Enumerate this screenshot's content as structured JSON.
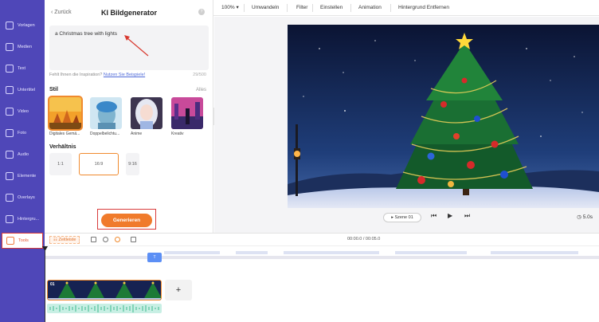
{
  "sidebar": {
    "items": [
      {
        "label": "Vorlagen",
        "icon": "layers-icon",
        "name": "sidebar-item-vorlagen"
      },
      {
        "label": "Medien",
        "icon": "media-icon",
        "name": "sidebar-item-medien"
      },
      {
        "label": "Text",
        "icon": "text-icon",
        "name": "sidebar-item-text"
      },
      {
        "label": "Untertitel",
        "icon": "subtitle-icon",
        "name": "sidebar-item-untertitel"
      },
      {
        "label": "Video",
        "icon": "video-icon",
        "name": "sidebar-item-video"
      },
      {
        "label": "Foto",
        "icon": "photo-icon",
        "name": "sidebar-item-foto"
      },
      {
        "label": "Audio",
        "icon": "music-icon",
        "name": "sidebar-item-audio"
      },
      {
        "label": "Elemente",
        "icon": "shapes-icon",
        "name": "sidebar-item-elemente"
      },
      {
        "label": "Overlays",
        "icon": "overlay-icon",
        "name": "sidebar-item-overlays"
      },
      {
        "label": "Hintergru...",
        "icon": "background-icon",
        "name": "sidebar-item-hintergrund"
      },
      {
        "label": "Tools",
        "icon": "toolbox-icon",
        "name": "sidebar-item-tools",
        "active": true
      }
    ]
  },
  "panel": {
    "back_label": "Zurück",
    "title": "KI Bildgenerator",
    "help_icon": "?",
    "prompt_text": "a Christmas tree with lights",
    "inspiration_text": "Fehlt Ihnen die Inspiration?",
    "inspiration_link": "Nutzen Sie Beispiele!",
    "char_counter": "29/500",
    "style_label": "Stil",
    "all_label": "Alles",
    "styles": [
      {
        "name": "Digitales Gemä...",
        "selected": true
      },
      {
        "name": "Doppelbelichtu..."
      },
      {
        "name": "Anime"
      },
      {
        "name": "Kreativ"
      }
    ],
    "ratio_label": "Verhältnis",
    "ratios": [
      {
        "label": "1:1"
      },
      {
        "label": "16:9",
        "selected": true
      },
      {
        "label": "9:16"
      }
    ],
    "generate_label": "Generieren"
  },
  "toolbar": {
    "zoom": "100%",
    "items": [
      "Umwandeln",
      "Filter",
      "Einstellen",
      "Animation",
      "Hintergrund Entfernen"
    ]
  },
  "preview": {
    "scene_label": "Szene",
    "scene_number": "01",
    "duration": "5.0s"
  },
  "timeline": {
    "tab_label": "Zeitleiste",
    "timecode": "00:00.0 / 00:05.0",
    "text_badge": "T",
    "clip_number": "01",
    "add_label": "+"
  },
  "colors": {
    "sidebar": "#4f47b8",
    "accent": "#f07b2c",
    "highlight_box": "#d83b3b"
  }
}
